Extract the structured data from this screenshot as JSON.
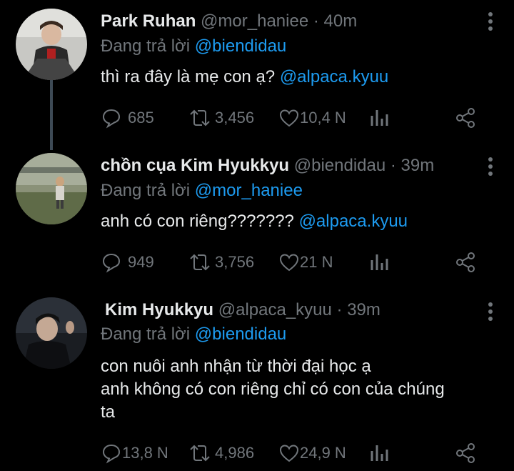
{
  "tweets": [
    {
      "name": "Park Ruhan",
      "handle": "@mor_haniee",
      "time": "· 40m",
      "reply_label": "Đang trả lời",
      "reply_to": "@biendidau",
      "text": "thì ra đây là mẹ con ạ?",
      "text_mention": "@alpaca.kyuu",
      "text_lines": [],
      "replies": "685",
      "retweets": "3,456",
      "likes": "10,4 N"
    },
    {
      "name": "chồn cụa Kim Hyukkyu",
      "handle": "@biendidau",
      "time": "· 39m",
      "reply_label": "Đang trả lời",
      "reply_to": "@mor_haniee",
      "text": "anh có con riêng???????",
      "text_mention": "@alpaca.kyuu",
      "text_lines": [],
      "replies": "949",
      "retweets": "3,756",
      "likes": "21 N"
    },
    {
      "name": "Kim Hyukkyu",
      "handle": "@alpaca_kyuu",
      "time": "· 39m",
      "reply_label": "Đang trả lời",
      "reply_to": "@biendidau",
      "text_lines": [
        "con nuôi anh nhận từ thời đại học ạ",
        "anh không có con riêng chỉ có con của chúng",
        "ta"
      ],
      "replies": "13,8 N",
      "retweets": "4,986",
      "likes": "24,9 N"
    }
  ],
  "icons": [
    "reply-icon",
    "retweet-icon",
    "like-icon",
    "analytics-icon",
    "share-icon",
    "more-options-icon"
  ],
  "colors": {
    "background": "#000000",
    "text": "#e7e9ea",
    "muted": "#71767b",
    "accent": "#1d9bf0"
  }
}
